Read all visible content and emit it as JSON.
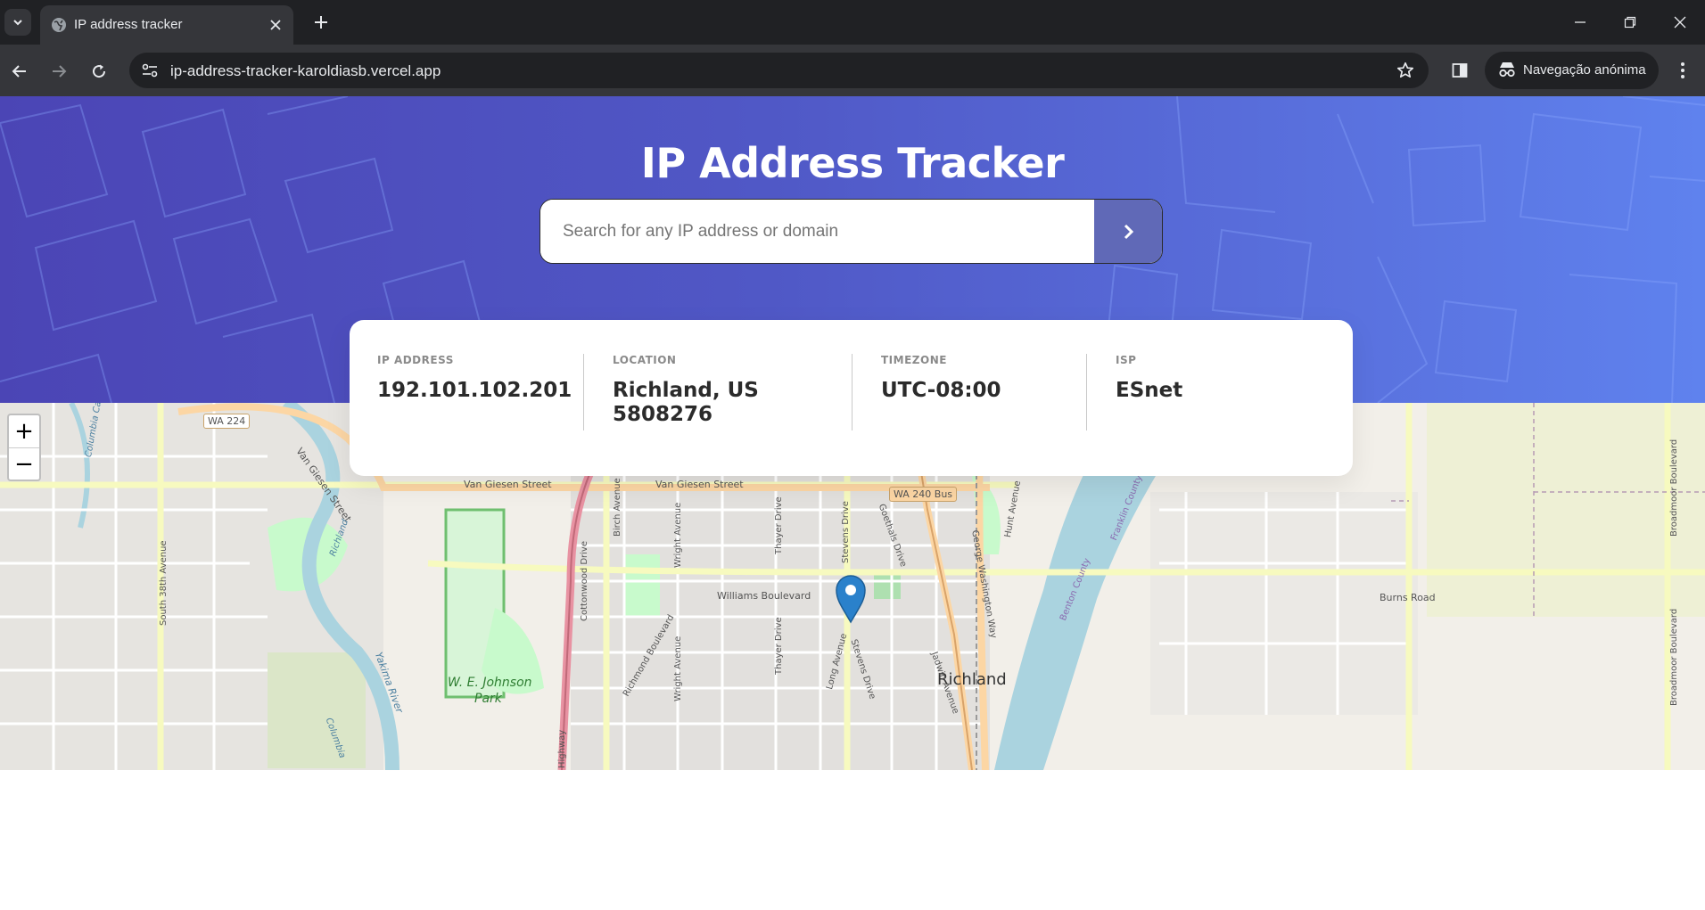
{
  "browser": {
    "tab_title": "IP address tracker",
    "url": "ip-address-tracker-karoldiasb.vercel.app",
    "incognito_label": "Navegação anónima",
    "icons": [
      "tab-search-icon",
      "globe-icon",
      "close-icon",
      "plus-icon",
      "minimize-icon",
      "restore-icon",
      "close-window-icon",
      "back-icon",
      "forward-icon",
      "reload-icon",
      "site-info-icon",
      "star-icon",
      "side-panel-icon",
      "incognito-icon",
      "kebab-menu-icon"
    ]
  },
  "page": {
    "title": "IP Address Tracker",
    "search_placeholder": "Search for any IP address or domain",
    "search_button_icon": "chevron-right-icon"
  },
  "info": {
    "ip_label": "IP Address",
    "ip_value": "192.101.102.201",
    "location_label": "Location",
    "location_line1": "Richland, US",
    "location_line2": "5808276",
    "timezone_label": "Timezone",
    "timezone_value": "UTC-08:00",
    "isp_label": "ISP",
    "isp_value": "ESnet"
  },
  "map": {
    "zoom_in": "+",
    "zoom_out": "−",
    "labels": {
      "wa224": "WA 224",
      "van_giesen_street_1": "Van Giesen Street",
      "van_giesen_street_2": "Van Giesen Street",
      "van_giesen_street_diag": "Van Giesen Street",
      "wa240bus": "WA 240 Bus",
      "williams_blvd": "Williams Boulevard",
      "burns_road": "Burns Road",
      "richland_city": "Richland",
      "we_johnson_park_1": "W. E. Johnson",
      "we_johnson_park_2": "Park",
      "south_38th": "South 38th Avenue",
      "cottonwood": "Cottonwood Drive",
      "birch": "Birch Avenue",
      "wright_1": "Wright Avenue",
      "wright_2": "Wright Avenue",
      "thayer_1": "Thayer Drive",
      "thayer_2": "Thayer Drive",
      "stevens_1": "Stevens Drive",
      "stevens_2": "Stevens Drive",
      "goethals": "Goethals Drive",
      "george_washington": "George Washington Way",
      "jadwin": "Jadwin Avenue",
      "hunt": "Hunt Avenue",
      "long_ave": "Long Avenue",
      "richmond": "Richmond Boulevard",
      "benton_county": "Benton County",
      "franklin_county": "Franklin County",
      "broadmoor_1": "Broadmoor Boulevard",
      "broadmoor_2": "Broadmoor Boulevard",
      "yakima_river": "Yakima River",
      "columbia": "Columbia",
      "columbia_canal": "Columbia Canal",
      "richland_river_label": "Richland",
      "highway": "Highway"
    },
    "marker_icon": "map-pin-icon",
    "colors": {
      "water": "#aad3df",
      "land": "#f2efe9",
      "park": "#c8facc",
      "residential": "#e0dfdf",
      "primary_road": "#fcd6a4",
      "secondary_road": "#f7fabf",
      "motorway": "#e892a2",
      "marker": "#2a81cb"
    }
  },
  "theme": {
    "hero_gradient_start": "#4b45b5",
    "hero_gradient_end": "#5f82ee",
    "search_button": "#6069b7",
    "text_dark": "#2b2b2b",
    "label_gray": "#8a8a8a"
  }
}
